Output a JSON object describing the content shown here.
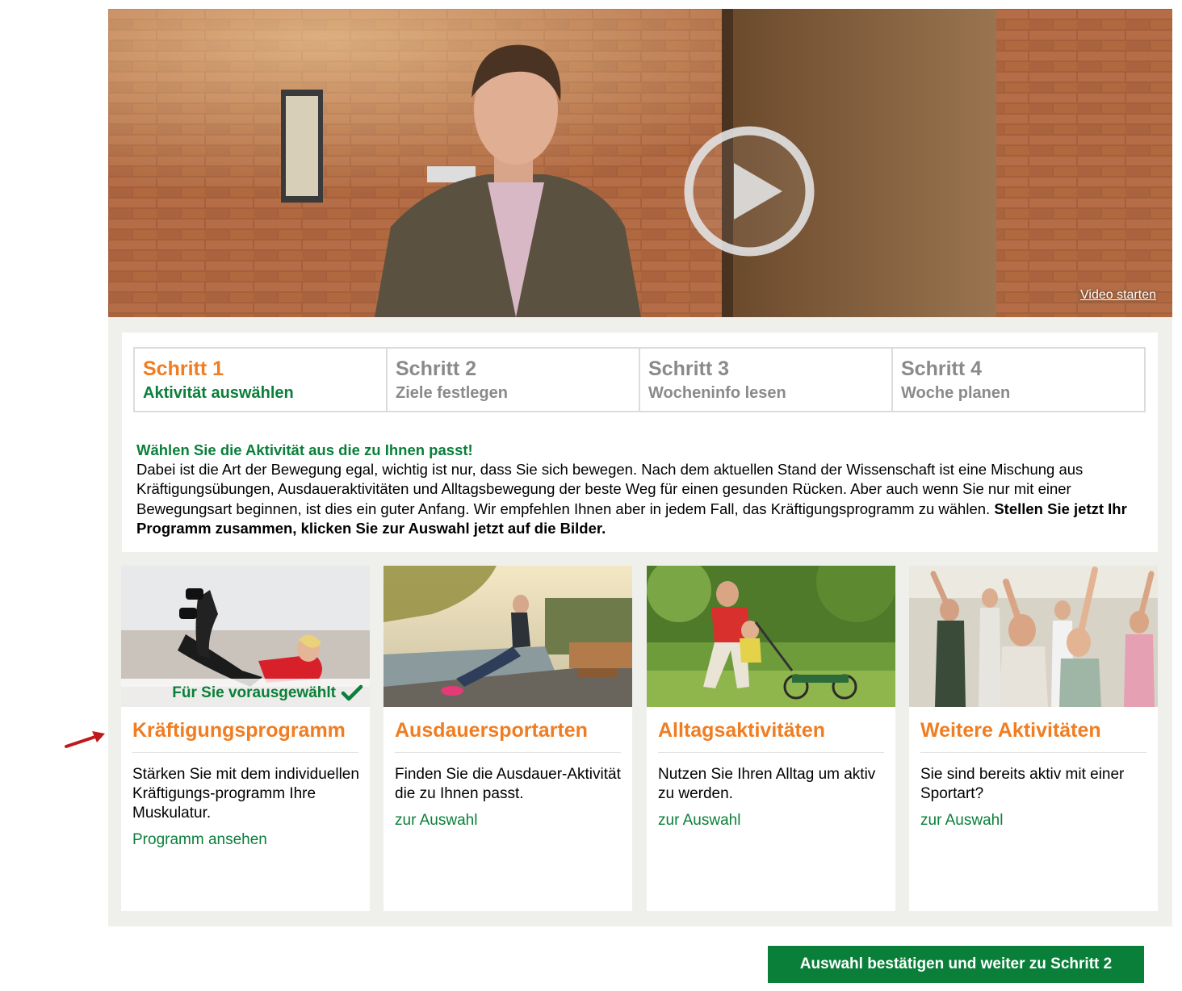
{
  "video": {
    "link_label": "Video starten",
    "play_icon": "play-circle-icon"
  },
  "steps": [
    {
      "number": "Schritt 1",
      "label": "Aktivität auswählen",
      "active": true
    },
    {
      "number": "Schritt 2",
      "label": "Ziele festlegen",
      "active": false
    },
    {
      "number": "Schritt 3",
      "label": "Wocheninfo lesen",
      "active": false
    },
    {
      "number": "Schritt 4",
      "label": "Woche planen",
      "active": false
    }
  ],
  "intro": {
    "headline": "Wählen Sie die Aktivität aus die zu Ihnen passt!",
    "body": "Dabei ist die Art der Bewegung egal, wichtig ist nur, dass Sie sich bewegen. Nach dem aktuellen Stand der Wissenschaft ist eine Mischung aus Kräftigungsübungen, Ausdaueraktivitäten und Alltagsbewegung der beste Weg für einen gesunden Rücken. Aber auch wenn Sie nur mit einer Bewegungsart beginnen, ist dies ein guter Anfang. Wir empfehlen Ihnen aber in jedem Fall, das Kräftigungsprogramm zu wählen.",
    "cta": "Stellen Sie jetzt Ihr Programm zusammen, klicken Sie zur Auswahl jetzt auf die Bilder."
  },
  "cards": [
    {
      "title": "Kräftigungsprogramm",
      "description": "Stärken Sie mit dem individuellen Kräftigungs-programm Ihre Muskulatur.",
      "link": "Programm ansehen",
      "badge": "Für Sie vorausgewählt"
    },
    {
      "title": "Ausdauersportarten",
      "description": "Finden Sie die Ausdauer-Aktivität die zu Ihnen passt.",
      "link": "zur Auswahl"
    },
    {
      "title": "Alltagsaktivitäten",
      "description": "Nutzen Sie Ihren Alltag um aktiv zu werden.",
      "link": "zur Auswahl"
    },
    {
      "title": "Weitere Aktivitäten",
      "description": "Sie sind bereits aktiv mit einer Sportart?",
      "link": "zur Auswahl"
    }
  ],
  "confirm_button": "Auswahl bestätigen und weiter zu Schritt 2",
  "colors": {
    "orange": "#f07d21",
    "green": "#0a7f3a",
    "panel": "#efefeb",
    "arrow": "#c01818"
  }
}
